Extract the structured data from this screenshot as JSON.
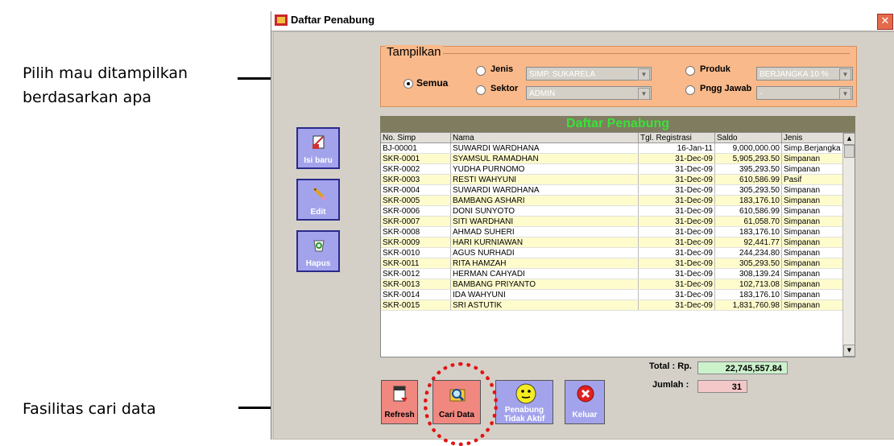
{
  "annotations": {
    "top_line1": "Pilih mau ditampilkan",
    "top_line2": "berdasarkan apa",
    "bottom": "Fasilitas cari data"
  },
  "window": {
    "title": "Daftar Penabung",
    "close_symbol": "✕"
  },
  "filter": {
    "legend": "Tampilkan",
    "semua": "Semua",
    "jenis": "Jenis",
    "sektor": "Sektor",
    "produk": "Produk",
    "pngg_jawab": "Pngg Jawab",
    "jenis_value": "SIMP. SUKARELA",
    "sektor_value": "ADMIN",
    "produk_value": "BERJANGKA 10 %",
    "pngg_value": "-",
    "selected": "semua"
  },
  "grid": {
    "title": "Daftar Penabung",
    "columns": [
      "No. Simp",
      "Nama",
      "Tgl. Registrasi",
      "Saldo",
      "Jenis"
    ],
    "rows": [
      [
        "BJ-00001",
        "SUWARDI WARDHANA",
        "16-Jan-11",
        "9,000,000.00",
        "Simp.Berjangka"
      ],
      [
        "SKR-0001",
        "SYAMSUL RAMADHAN",
        "31-Dec-09",
        "5,905,293.50",
        "Simpanan"
      ],
      [
        "SKR-0002",
        "YUDHA PURNOMO",
        "31-Dec-09",
        "395,293.50",
        "Simpanan"
      ],
      [
        "SKR-0003",
        "RESTI WAHYUNI",
        "31-Dec-09",
        "610,586.99",
        "Pasif"
      ],
      [
        "SKR-0004",
        "SUWARDI WARDHANA",
        "31-Dec-09",
        "305,293.50",
        "Simpanan"
      ],
      [
        "SKR-0005",
        "BAMBANG ASHARI",
        "31-Dec-09",
        "183,176.10",
        "Simpanan"
      ],
      [
        "SKR-0006",
        "DONI SUNYOTO",
        "31-Dec-09",
        "610,586.99",
        "Simpanan"
      ],
      [
        "SKR-0007",
        "SITI WARDHANI",
        "31-Dec-09",
        "61,058.70",
        "Simpanan"
      ],
      [
        "SKR-0008",
        "AHMAD SUHERI",
        "31-Dec-09",
        "183,176.10",
        "Simpanan"
      ],
      [
        "SKR-0009",
        "HARI KURNIAWAN",
        "31-Dec-09",
        "92,441.77",
        "Simpanan"
      ],
      [
        "SKR-0010",
        "AGUS NURHADI",
        "31-Dec-09",
        "244,234.80",
        "Simpanan"
      ],
      [
        "SKR-0011",
        "RITA HAMZAH",
        "31-Dec-09",
        "305,293.50",
        "Simpanan"
      ],
      [
        "SKR-0012",
        "HERMAN CAHYADI",
        "31-Dec-09",
        "308,139.24",
        "Simpanan"
      ],
      [
        "SKR-0013",
        "BAMBANG PRIYANTO",
        "31-Dec-09",
        "102,713.08",
        "Simpanan"
      ],
      [
        "SKR-0014",
        "IDA WAHYUNI",
        "31-Dec-09",
        "183,176.10",
        "Simpanan"
      ],
      [
        "SKR-0015",
        "SRI ASTUTIK",
        "31-Dec-09",
        "1,831,760.98",
        "Simpanan"
      ]
    ]
  },
  "side_buttons": {
    "isi_baru": "Isi baru",
    "edit": "Edit",
    "hapus": "Hapus"
  },
  "totals": {
    "total_label": "Total : Rp.",
    "total_value": "22,745,557.84",
    "jumlah_label": "Jumlah :",
    "jumlah_value": "31"
  },
  "bottom_buttons": {
    "refresh": "Refresh",
    "cari_data": "Cari Data",
    "penabung_line1": "Penabung",
    "penabung_line2": "Tidak Aktif",
    "keluar": "Keluar"
  },
  "colors": {
    "filter_bg": "#f9b98a",
    "grid_title_bg": "#807c60",
    "grid_title_text": "#39e23a",
    "alt_row": "#fefccc",
    "side_button": "#a3a3ec",
    "refresh_button": "#f08880",
    "total_box": "#ccf2cc",
    "jumlah_box": "#f4c8c8",
    "circle": "#e31414"
  },
  "icons": {
    "isi_baru": "new-document-icon",
    "edit": "pencil-icon",
    "hapus": "recycle-bin-icon",
    "refresh": "refresh-document-icon",
    "cari_data": "magnifier-folder-icon",
    "penabung_tidak_aktif": "smiley-icon",
    "keluar": "close-x-icon"
  }
}
